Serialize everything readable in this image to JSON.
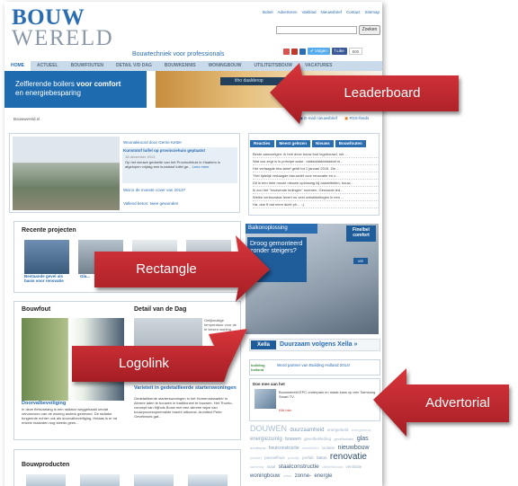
{
  "header": {
    "logo_top": "BOUW",
    "logo_bottom": "WERELD",
    "tagline": "Bouwtechniek voor professionals",
    "top_links": [
      "Bobel",
      "Adverteren",
      "Vakblad",
      "Nieuwsbrief",
      "Contact",
      "Sitemap"
    ],
    "search": {
      "placeholder": "",
      "button": "Zoeken"
    },
    "social": {
      "volgen": "Volgen",
      "like": "Like",
      "like_count": "500"
    }
  },
  "nav": {
    "items": [
      "HOME",
      "ACTUEEL",
      "BOUWFOUTEN",
      "DETAIL V/D DAG",
      "BOUWKENNIS",
      "WONINGBOUW",
      "UTILITEITSBOUW",
      "VACATURES"
    ],
    "active_index": 0
  },
  "promo": {
    "line1": "Zelflerende boilers",
    "line1_bold": " voor comfort",
    "line2": "en energiebesparing"
  },
  "leaderboard_ad": {
    "brand": "itho daalderop"
  },
  "breadcrumb": "Bouwwereld.nl",
  "newsletter": {
    "email": "E-mail nieuwsbrief",
    "rss": "RSS-feeds"
  },
  "featured": {
    "links": [
      "Woonakkoord door Gerrie Ketter",
      "Kunststof luifel op provinciehuis geplaatst",
      "Wat is de moeste cover van 2013?",
      "Vallend beton: twee gewonden"
    ],
    "active": {
      "date": "18 december 2013",
      "summary": "Op het nieuwe gedeelte van het Provinciehuis in Haarlem is afgelopen vrijdag een kunststof luifel ge...",
      "more": "Lees meer"
    }
  },
  "lists": {
    "tabs": [
      "Reacties",
      "Meest gelezen",
      "Nieuws",
      "Bouwfouten"
    ],
    "rows": [
      "Beste aanvoelgen: ik heb deze bouw fout ingebouwd, mit ...",
      "Wat vos zegt is in principe waar : ddddddddddddddd ni...",
      "Het verlaagde btw-tarief geldt tot 1 januari 2015. Zie ...",
      "\"Het tijdelijk verlaagde btw-tarief voor renovatie en o...",
      "Dit is een hele mooie nieuwe oplossing bij calamiteiten, bouw...",
      "Ik zou het \"knuisende ledingen\" noemen. Gewoude led...",
      "Welke verbouwkar levert nu veel ontwikkelingen in een ...",
      "Ha, doe ff dat mem dicht ph... :-)"
    ]
  },
  "recent": {
    "title": "Recente projecten",
    "items": [
      "Bestaande gevel als basis voor renovatie",
      "Gla..."
    ]
  },
  "rect_ad": {
    "head": "Balkonoplossing",
    "panel": "Droog gemonteerd zonder steigers?",
    "logo": "Finelbel comfort",
    "btn": "VIE"
  },
  "bouwfout": {
    "title": "Bouwfout",
    "link": "Doorvalbeveiliging",
    "text": "In deze fietsvariang is een radiator weggehaald omdat vervanvoen van de woning anders gesteund. De radiator fungeerde echter ook als doorvalbeveiliging. Helaas is er na enkele maanden nog steeds geen..."
  },
  "detail": {
    "title": "Detail van de Dag",
    "side": "Gelijkmatige temperatuur voor de te kiezen woning",
    "link": "Varieteit in gedetailleerde starterswoningen",
    "text": "Gedetailleerde starterswoningen in het Homeruskwartier in Almere laten te bouwen in traditioneel te bouwen. Het Thonto-concept van Nijhuis Bouw met een slimme wijze van bouwprocesopnemalde bracht uitkomst. Architect Peter Gevelbroek gaf..."
  },
  "xella": {
    "badge": "Xella",
    "text": "Duurzaam volgens Xella »"
  },
  "partner": {
    "logo": "building holland",
    "text": "Word partner van Building Holland 2014!"
  },
  "advertorial": {
    "title": "Doe mee aan het",
    "text": "Bouwwereld EPC onderpain en maak kans op een Samsung Smart TV.",
    "more": "Klik hier"
  },
  "tags": [
    {
      "t": "DOUWEN",
      "s": 9,
      "c": "#a8bfd5"
    },
    {
      "t": "duurzaamheid",
      "s": 6,
      "c": "#7f9bb8"
    },
    {
      "t": "energiebeld",
      "s": 4.5,
      "c": "#9fb3c7"
    },
    {
      "t": "energiebesp",
      "s": 4,
      "c": "#b7c7d6"
    },
    {
      "t": "energiezuinig",
      "s": 6,
      "c": "#8aa4bf"
    },
    {
      "t": "bouwen",
      "s": 5,
      "c": "#7f9bb8"
    },
    {
      "t": "gevelbekleding",
      "s": 4.5,
      "c": "#9fb3c7"
    },
    {
      "t": "gevelisolatie",
      "s": 4,
      "c": "#9fb3c7"
    },
    {
      "t": "glas",
      "s": 7,
      "c": "#3f5f80"
    },
    {
      "t": "houtbouw",
      "s": 4,
      "c": "#9fb3c7"
    },
    {
      "t": "houtconstructie",
      "s": 5,
      "c": "#7f9bb8"
    },
    {
      "t": "installaties",
      "s": 4,
      "c": "#b7c7d6"
    },
    {
      "t": "isolatie",
      "s": 4.5,
      "c": "#9fb3c7"
    },
    {
      "t": "nieuwbouw",
      "s": 7,
      "c": "#3f5f80"
    },
    {
      "t": "passief",
      "s": 4,
      "c": "#b7c7d6"
    },
    {
      "t": "passiefhuis",
      "s": 4.5,
      "c": "#9fb3c7"
    },
    {
      "t": "practijk",
      "s": 4,
      "c": "#b7c7d6"
    },
    {
      "t": "prefab",
      "s": 4.5,
      "c": "#9fb3c7"
    },
    {
      "t": "beton",
      "s": 4.5,
      "c": "#7f9bb8"
    },
    {
      "t": "renovatie",
      "s": 10,
      "c": "#2e4d6d"
    },
    {
      "t": "sanering",
      "s": 4,
      "c": "#b7c7d6"
    },
    {
      "t": "staal",
      "s": 4.5,
      "c": "#9fb3c7"
    },
    {
      "t": "staalconstructie",
      "s": 6.5,
      "c": "#3f5f80"
    },
    {
      "t": "utiliteitsbouw",
      "s": 4,
      "c": "#b7c7d6"
    },
    {
      "t": "ventilatie",
      "s": 4.5,
      "c": "#9fb3c7"
    },
    {
      "t": "woningbouw",
      "s": 6,
      "c": "#3f5f80"
    },
    {
      "t": "zetas",
      "s": 4,
      "c": "#b7c7d6"
    },
    {
      "t": "zonne-",
      "s": 6,
      "c": "#3f5f80"
    },
    {
      "t": "energie",
      "s": 6,
      "c": "#3f5f80"
    }
  ],
  "producten": {
    "title": "Bouwproducten"
  },
  "callouts": {
    "leaderboard": "Leaderboard",
    "rectangle": "Rectangle",
    "logolink": "Logolink",
    "advertorial": "Advertorial"
  },
  "colors": {
    "accent": "#2a6db0",
    "callout": "#c0272d",
    "nav": "#c9dbea"
  }
}
